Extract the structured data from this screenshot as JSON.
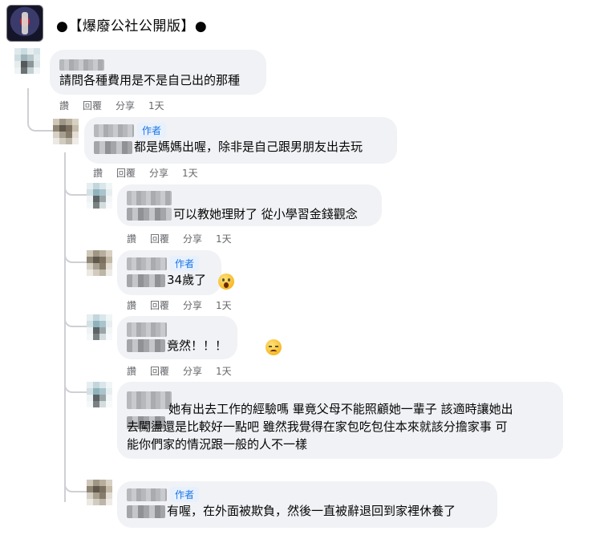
{
  "group": {
    "name": "●【爆廢公社公開版】●"
  },
  "actions": {
    "like": "讚",
    "reply": "回覆",
    "share": "分享"
  },
  "author_badge": "作者",
  "comments": [
    {
      "text": "請問各種費用是不是自己出的那種",
      "time": "1天",
      "author": false,
      "emoji": ""
    },
    {
      "text": "都是媽媽出喔，除非是自己跟男朋友出去玩",
      "time": "1天",
      "author": true,
      "emoji": ""
    },
    {
      "text": "可以教她理財了 從小學習金錢觀念",
      "time": "1天",
      "author": false,
      "emoji": ""
    },
    {
      "text": "34歲了",
      "time": "1天",
      "author": true,
      "emoji": "astonished-face"
    },
    {
      "text": "竟然！！！",
      "time": "1天",
      "author": false,
      "emoji": "sad-tear-face"
    },
    {
      "text_lines": [
        "她有出去工作的經驗嗎 畢竟父母不能照顧她一輩子 該適時讓她出",
        "去闖盪還是比較好一點吧 雖然我覺得在家包吃包住本來就該分擔家事 可",
        "能你們家的情況跟一般的人不一樣"
      ],
      "author": false,
      "emoji": ""
    },
    {
      "text": "有喔，在外面被欺負，然後一直被辭退回到家裡休養了",
      "author": true,
      "emoji": ""
    }
  ],
  "colors": {
    "bubble": "#f0f2f5",
    "action_text": "#65676b",
    "badge_bg": "#e7f0fd",
    "badge_text": "#1b74e4",
    "thread_line": "#ced0d4"
  }
}
